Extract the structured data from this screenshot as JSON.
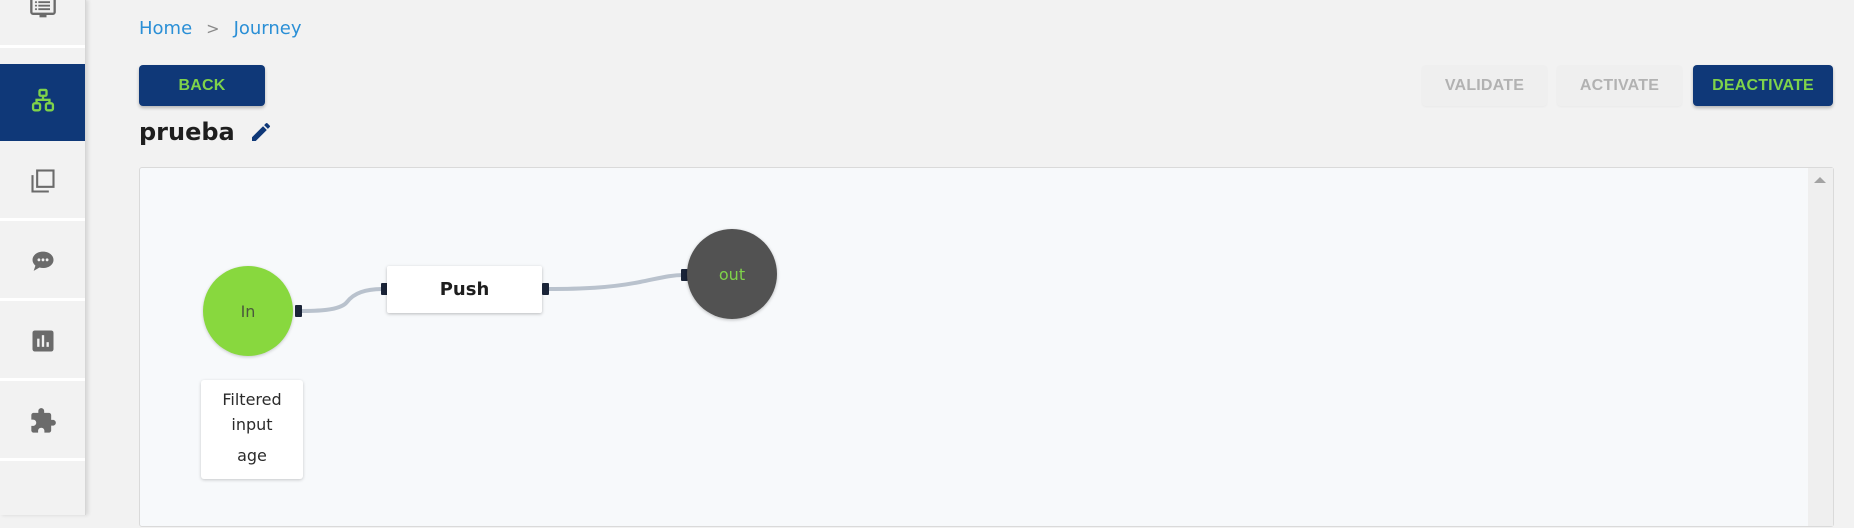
{
  "sidebar": {
    "items": [
      {
        "name": "dashboard",
        "icon": "monitor-list-icon",
        "active": false
      },
      {
        "name": "journeys",
        "icon": "network-tree-icon",
        "active": true
      },
      {
        "name": "templates",
        "icon": "copy-stack-icon",
        "active": false
      },
      {
        "name": "messages",
        "icon": "chat-bubble-icon",
        "active": false
      },
      {
        "name": "analytics",
        "icon": "bar-chart-icon",
        "active": false
      },
      {
        "name": "integrations",
        "icon": "puzzle-icon",
        "active": false
      }
    ]
  },
  "breadcrumb": {
    "items": [
      "Home",
      "Journey"
    ],
    "separator": ">"
  },
  "toolbar": {
    "back_label": "BACK",
    "validate_label": "VALIDATE",
    "activate_label": "ACTIVATE",
    "deactivate_label": "DEACTIVATE",
    "validate_disabled": true,
    "activate_disabled": true
  },
  "journey": {
    "title": "prueba",
    "edit_icon": "pencil-icon"
  },
  "flow": {
    "nodes": {
      "in": {
        "label": "In",
        "color": "#88d83e"
      },
      "push": {
        "label": "Push"
      },
      "out": {
        "label": "out",
        "color": "#525252"
      }
    },
    "filter_card": {
      "line1": "Filtered",
      "line2": "input",
      "field": "age"
    },
    "edges": [
      {
        "from": "in",
        "to": "push"
      },
      {
        "from": "push",
        "to": "out"
      }
    ]
  },
  "colors": {
    "brand_navy": "#0f3878",
    "brand_green": "#7fd34a",
    "link_blue": "#2a8fd6"
  }
}
